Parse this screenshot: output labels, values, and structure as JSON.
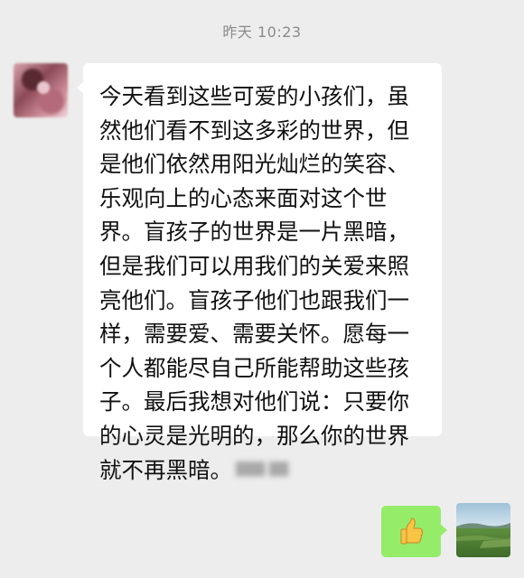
{
  "chat": {
    "timestamp": "昨天 10:23",
    "received_message": "今天看到这些可爱的小孩们，虽然他们看不到这多彩的世界，但是他们依然用阳光灿烂的笑容、乐观向上的心态来面对这个世界。盲孩子的世界是一片黑暗，但是我们可以用我们的关爱来照亮他们。盲孩子他们也跟我们一样，需要爱、需要关怀。愿每一个人都能尽自己所能帮助这些孩子。最后我想对他们说：只要你的心灵是光明的，那么你的世界就不再黑暗。",
    "sent_sticker": "thumbs-up-icon",
    "colors": {
      "background": "#ededed",
      "received_bubble": "#ffffff",
      "sent_bubble": "#95ec69",
      "timestamp_text": "#8a8a8a"
    }
  }
}
